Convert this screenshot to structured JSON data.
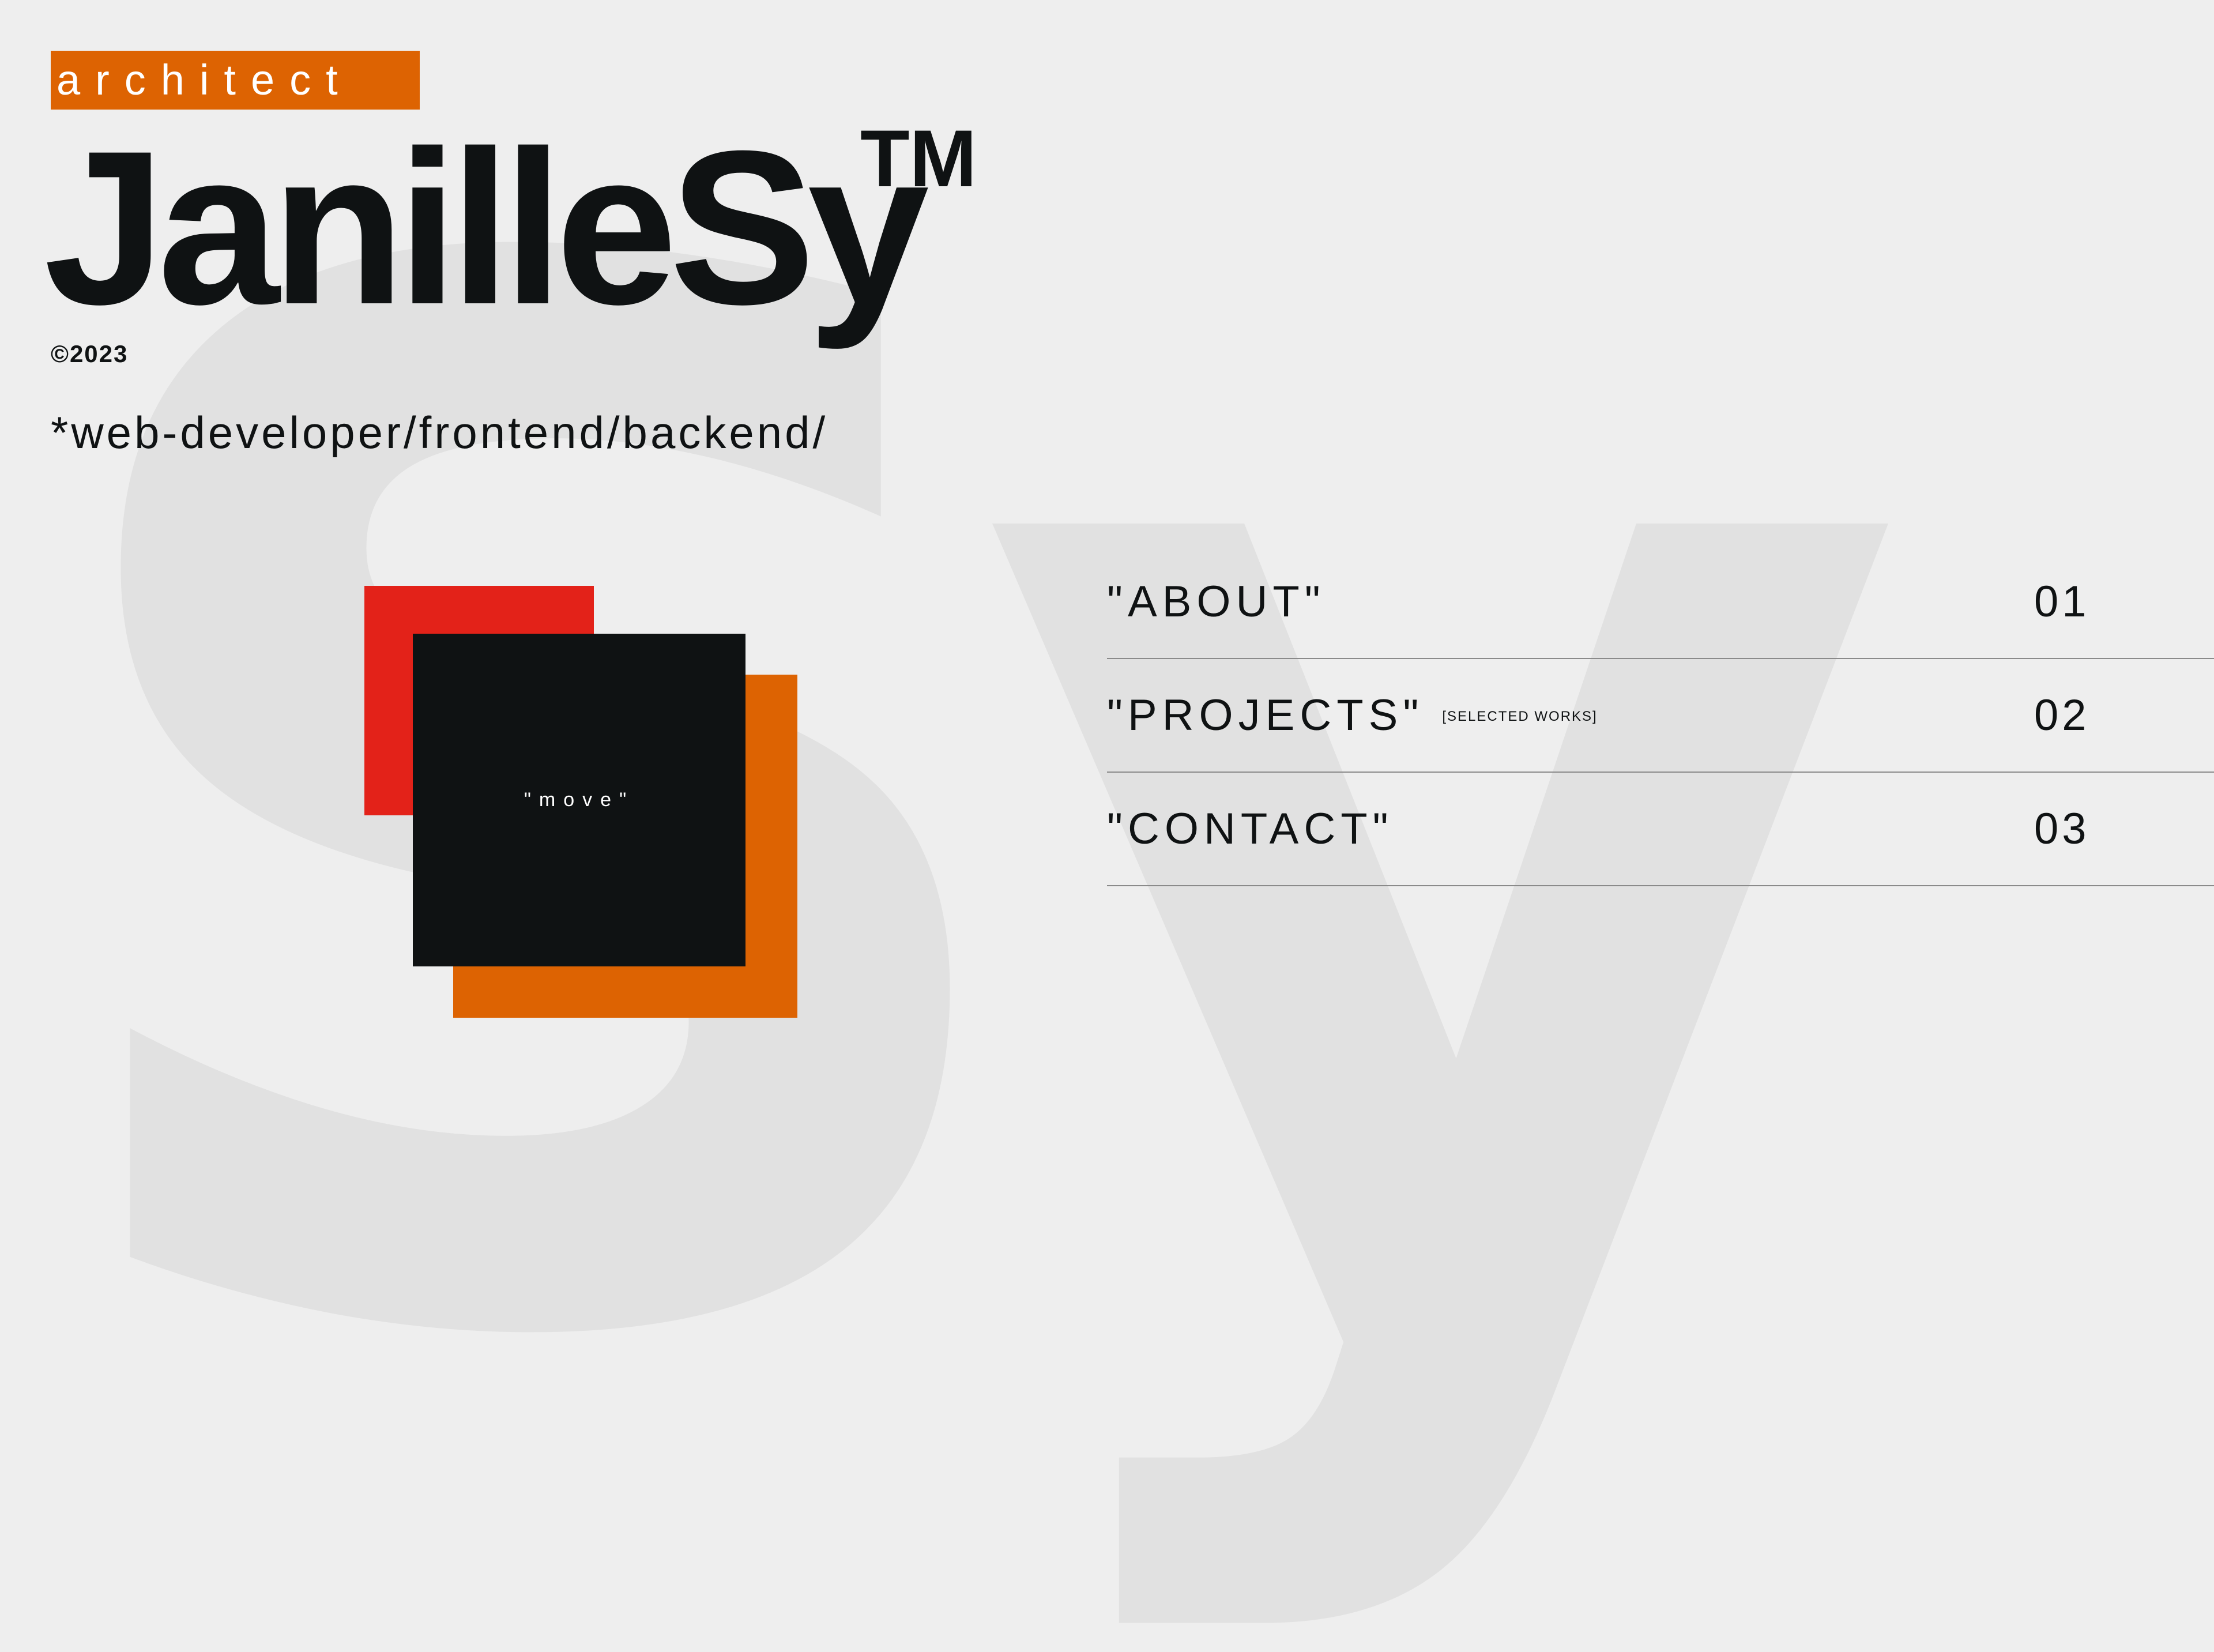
{
  "background_monogram": "Sy",
  "header": {
    "role": "architect",
    "name": "JanilleSy",
    "trademark": "TM",
    "copyright": "©2023",
    "tagline": "*web-developer/frontend/backend/"
  },
  "hero": {
    "move_label": "\"move\""
  },
  "nav": {
    "items": [
      {
        "label": "\"ABOUT\"",
        "note": "",
        "number": "01"
      },
      {
        "label": "\"PROJECTS\"",
        "note": "[SELECTED WORKS]",
        "number": "02"
      },
      {
        "label": "\"CONTACT\"",
        "note": "",
        "number": "03"
      }
    ]
  },
  "colors": {
    "background": "#eeeeee",
    "ink": "#0f1213",
    "accent_orange": "#dd6302",
    "accent_red": "#e32219",
    "monogram": "#e1e1e1",
    "divider": "#8a8a8a"
  }
}
